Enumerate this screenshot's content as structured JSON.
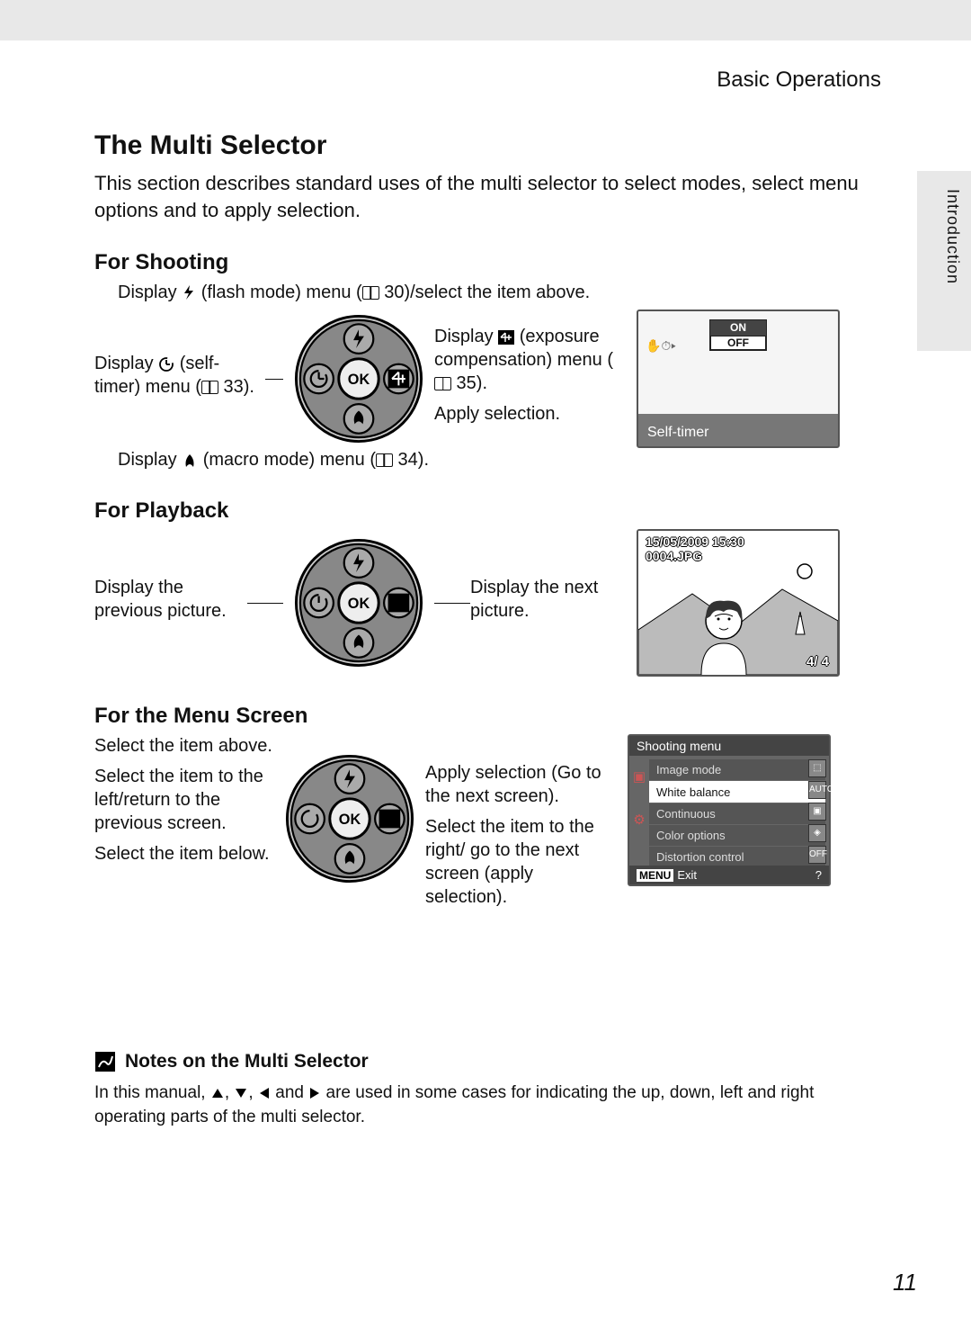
{
  "breadcrumb": "Basic Operations",
  "side_tab": "Introduction",
  "title": "The Multi Selector",
  "intro": "This section describes standard uses of the multi selector to select modes, select menu options and to apply selection.",
  "page_number": "11",
  "shooting": {
    "heading": "For Shooting",
    "top": "Display $FLASH (flash mode) menu ($REF 30)/select the item above.",
    "left": "Display $TIMER (self-timer) menu ($REF 33).",
    "right1": "Display $EXP (exposure compensation) menu ($REF 35).",
    "right2": "Apply selection.",
    "bottom": "Display $MACRO (macro mode) menu ($REF 34).",
    "lcd": {
      "on": "ON",
      "off": "OFF",
      "label": "Self-timer"
    }
  },
  "playback": {
    "heading": "For Playback",
    "left": "Display the previous picture.",
    "right": "Display the next picture.",
    "lcd": {
      "datetime": "15/05/2009 15:30",
      "file": "0004.JPG",
      "counter": "4/    4"
    }
  },
  "menu": {
    "heading": "For the Menu Screen",
    "left1": "Select the item above.",
    "left2": "Select the item to the left/return to the previous screen.",
    "left3": "Select the item below.",
    "right1": "Apply selection (Go to the next screen).",
    "right2": "Select the item to the right/ go to the next screen (apply selection).",
    "lcd": {
      "header": "Shooting menu",
      "items": [
        "Image mode",
        "White balance",
        "Continuous",
        "Color options",
        "Distortion control"
      ],
      "selected_index": 1,
      "footer_tag": "MENU",
      "footer_label": "Exit",
      "side_badges": [
        "⬚",
        "AUTO",
        "▣",
        "◈",
        "OFF"
      ]
    }
  },
  "notes": {
    "heading": "Notes on the Multi Selector",
    "body": "In this manual, $UP, $DOWN, $LEFT and $RIGHT are used in some cases for indicating the up, down, left and right operating parts of the multi selector."
  }
}
